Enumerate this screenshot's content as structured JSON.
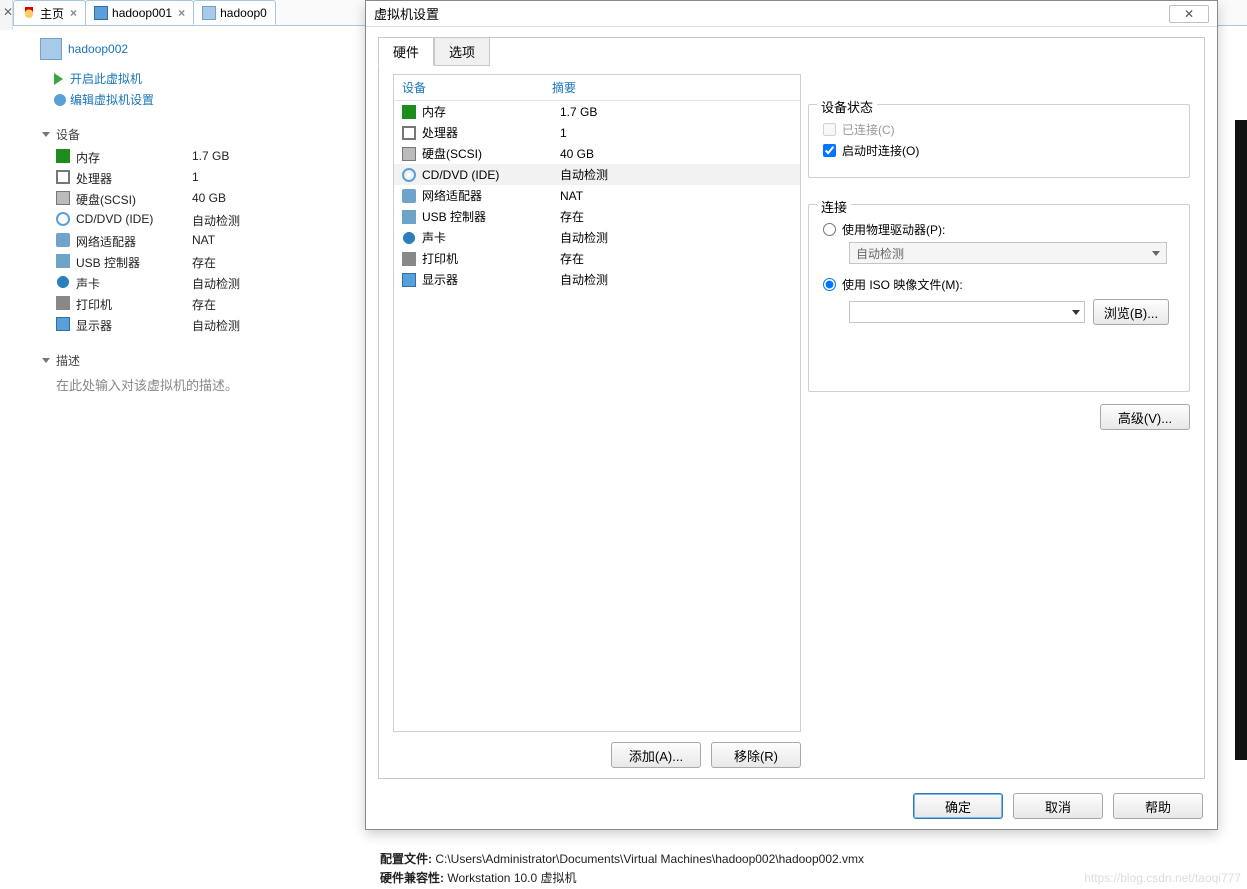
{
  "tabs": {
    "home": "主页",
    "vm1": "hadoop001",
    "vm2": "hadoop0"
  },
  "vm": {
    "title": "hadoop002",
    "power_on": "开启此虚拟机",
    "edit_settings": "编辑虚拟机设置"
  },
  "sections": {
    "devices": "设备",
    "description": "描述"
  },
  "left_devices": [
    {
      "icon": "mem",
      "name": "内存",
      "val": "1.7 GB"
    },
    {
      "icon": "cpu",
      "name": "处理器",
      "val": "1"
    },
    {
      "icon": "disk",
      "name": "硬盘(SCSI)",
      "val": "40 GB"
    },
    {
      "icon": "cd",
      "name": "CD/DVD (IDE)",
      "val": "自动检测"
    },
    {
      "icon": "net",
      "name": "网络适配器",
      "val": "NAT"
    },
    {
      "icon": "usb",
      "name": "USB 控制器",
      "val": "存在"
    },
    {
      "icon": "sound",
      "name": "声卡",
      "val": "自动检测"
    },
    {
      "icon": "print",
      "name": "打印机",
      "val": "存在"
    },
    {
      "icon": "disp",
      "name": "显示器",
      "val": "自动检测"
    }
  ],
  "desc_placeholder": "在此处输入对该虚拟机的描述。",
  "dialog": {
    "title": "虚拟机设置",
    "tab_hw": "硬件",
    "tab_opt": "选项",
    "head_dev": "设备",
    "head_sum": "摘要",
    "rows": [
      {
        "icon": "mem",
        "name": "内存",
        "val": "1.7 GB",
        "sel": false
      },
      {
        "icon": "cpu",
        "name": "处理器",
        "val": "1",
        "sel": false
      },
      {
        "icon": "disk",
        "name": "硬盘(SCSI)",
        "val": "40 GB",
        "sel": false
      },
      {
        "icon": "cd",
        "name": "CD/DVD (IDE)",
        "val": "自动检测",
        "sel": true
      },
      {
        "icon": "net",
        "name": "网络适配器",
        "val": "NAT",
        "sel": false
      },
      {
        "icon": "usb",
        "name": "USB 控制器",
        "val": "存在",
        "sel": false
      },
      {
        "icon": "sound",
        "name": "声卡",
        "val": "自动检测",
        "sel": false
      },
      {
        "icon": "print",
        "name": "打印机",
        "val": "存在",
        "sel": false
      },
      {
        "icon": "disp",
        "name": "显示器",
        "val": "自动检测",
        "sel": false
      }
    ],
    "add_btn": "添加(A)...",
    "remove_btn": "移除(R)",
    "status_label": "设备状态",
    "connected": "已连接(C)",
    "connect_start": "启动时连接(O)",
    "conn_label": "连接",
    "use_physical": "使用物理驱动器(P):",
    "auto_detect": "自动检测",
    "use_iso": "使用 ISO 映像文件(M):",
    "browse": "浏览(B)...",
    "advanced": "高级(V)...",
    "ok": "确定",
    "cancel": "取消",
    "help": "帮助"
  },
  "bottom": {
    "config_label": "配置文件:",
    "config_val": "C:\\Users\\Administrator\\Documents\\Virtual Machines\\hadoop002\\hadoop002.vmx",
    "compat_label": "硬件兼容性:",
    "compat_val": "Workstation 10.0 虚拟机"
  },
  "watermark": "https://blog.csdn.net/taoqi777"
}
